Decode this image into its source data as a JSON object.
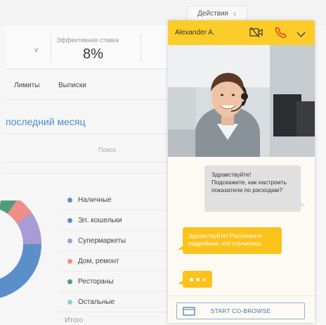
{
  "header": {
    "actions_label": "Действия"
  },
  "rate": {
    "label": "Эффективная ставка",
    "value": "8%"
  },
  "tabs": [
    {
      "label": "Лимиты"
    },
    {
      "label": "Выписки"
    }
  ],
  "section": {
    "title": "последний месяц",
    "search_label": "Поиск"
  },
  "legend": [
    {
      "label": "Наличные",
      "color": "#5b8fc9"
    },
    {
      "label": "Эл. кошельки",
      "color": "#5b8fc9"
    },
    {
      "label": "Супермаркеты",
      "color": "#a99bd4"
    },
    {
      "label": "Дом, ремонт",
      "color": "#ee8e8a"
    },
    {
      "label": "Рестораны",
      "color": "#4f9d78"
    },
    {
      "label": "Остальные",
      "color": "#8fd1de"
    }
  ],
  "total_label": "Итого",
  "chat": {
    "agent_name": "Alexander A.",
    "icons": [
      "camera-off-icon",
      "phone-icon",
      "chevron-down-icon"
    ],
    "agent_message": "Здравствуйте!\nПодскажите, как настроить показатели по расходам?",
    "agent_message_lines": [
      "Здравствуйте!",
      "Подскажите, как настроить",
      "показатели по расходам?"
    ],
    "user_message_lines": [
      "Здравствуйте! Расскажите",
      "подробнее, что случилось."
    ],
    "cobrowse_label": "START CO-BROWSE"
  },
  "colors": {
    "accent": "#fccc29",
    "link": "#4a8cc9",
    "cobrowse": "#3d79b8"
  }
}
